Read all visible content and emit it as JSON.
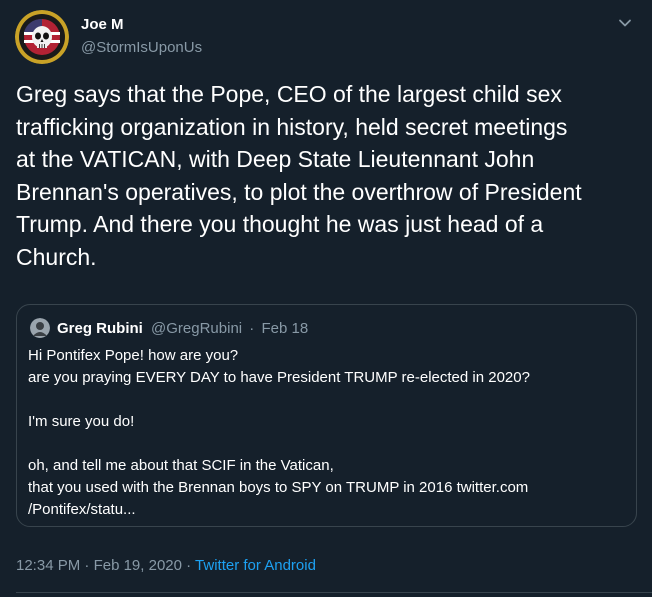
{
  "author": {
    "display_name": "Joe M",
    "handle": "@StormIsUponUs",
    "avatar_icon": "skull-badge-icon"
  },
  "tweet": {
    "text": "Greg says that the Pope, CEO of the largest child sex\ntrafficking organization in history, held secret meetings\nat the VATICAN, with Deep State Lieutennant John\nBrennan's operatives, to plot the overthrow of President\nTrump. And there you thought he was just head of a\nChurch."
  },
  "quoted_tweet": {
    "display_name": "Greg Rubini",
    "handle": "@GregRubini",
    "separator": "·",
    "date": "Feb 18",
    "lines": [
      "Hi Pontifex Pope! how are you?",
      "are you praying EVERY DAY to have President TRUMP re-elected in 2020?",
      "",
      "I'm sure you do!",
      "",
      "oh, and tell me about that SCIF in the Vatican,",
      "that you used with the Brennan boys to SPY on TRUMP in 2016 twitter.com",
      "/Pontifex/statu..."
    ]
  },
  "meta": {
    "time": "12:34 PM",
    "separator": "·",
    "date": "Feb 19, 2020",
    "source": "Twitter for Android"
  },
  "colors": {
    "background": "#15202b",
    "text": "#ffffff",
    "muted": "#8899a6",
    "link": "#1da1f2",
    "border": "#38444d"
  }
}
